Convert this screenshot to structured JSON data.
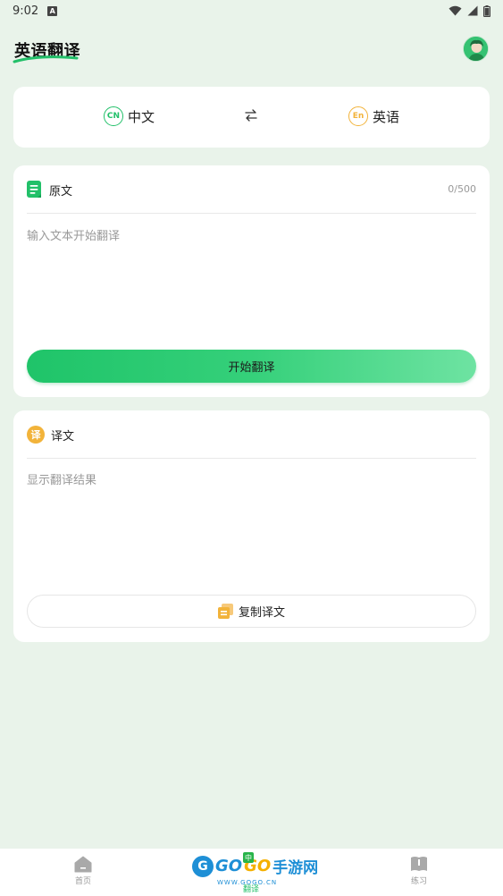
{
  "status": {
    "time": "9:02",
    "notif_glyph": "A"
  },
  "header": {
    "title": "英语翻译"
  },
  "languages": {
    "source": {
      "badge": "CN",
      "label": "中文"
    },
    "target": {
      "badge": "En",
      "label": "英语"
    },
    "swap_glyph": "⇄"
  },
  "source_card": {
    "title": "原文",
    "counter": "0/500",
    "placeholder": "输入文本开始翻译",
    "button_label": "开始翻译"
  },
  "result_card": {
    "badge": "译",
    "title": "译文",
    "placeholder": "显示翻译结果",
    "copy_label": "复制译文"
  },
  "nav": {
    "items": [
      {
        "label": "首页",
        "icon": "home-icon"
      },
      {
        "label": "翻译",
        "icon": "translate-icon"
      },
      {
        "label": "练习",
        "icon": "book-icon"
      }
    ]
  },
  "watermark": {
    "logo_glyph": "G",
    "go1": "GO",
    "go2": "GO",
    "cn": "手游网",
    "tag": "中",
    "url": "WWW.GOGO.CN"
  },
  "colors": {
    "background": "#e9f3ea",
    "primary_green": "#22c069",
    "accent_orange": "#f2b33a",
    "placeholder_gray": "#999999"
  }
}
